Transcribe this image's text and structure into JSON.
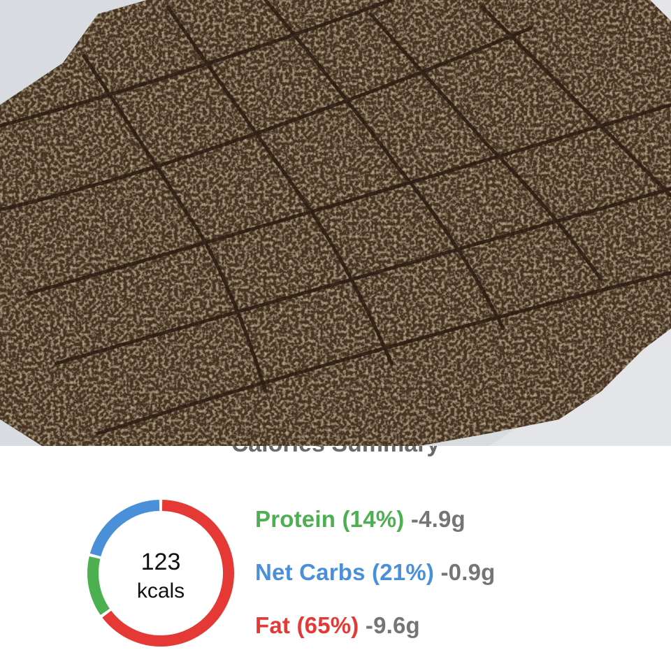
{
  "summary": {
    "heading": "Calories Summary",
    "calories": {
      "value": "123",
      "unit": "kcals"
    },
    "macros": [
      {
        "key": "protein",
        "label": "Protein (14%)",
        "amount": "-4.9g",
        "percent": 14,
        "color": "#4caf50"
      },
      {
        "key": "net-carbs",
        "label": "Net Carbs (21%)",
        "amount": "-0.9g",
        "percent": 21,
        "color": "#4a90d9"
      },
      {
        "key": "fat",
        "label": "Fat (65%)",
        "amount": "-9.6g",
        "percent": 65,
        "color": "#e53935"
      }
    ]
  },
  "colors": {
    "panel_bg": "#ffffff",
    "amount_text": "#757575",
    "background_paper": "#e9edf1",
    "cracker_brown": "#4a3424",
    "sesame": "#d6b37a"
  }
}
